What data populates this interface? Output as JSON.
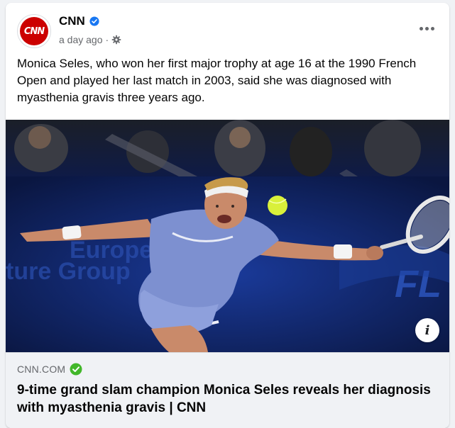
{
  "post": {
    "page_name": "CNN",
    "avatar_text": "CNN",
    "timestamp": "a day ago",
    "separator": "·",
    "body": "Monica Seles, who won her first major trophy at age 16 at the 1990 French Open and played her last match in 2003, said she was diagnosed with myasthenia gravis three years ago."
  },
  "photo": {
    "ad_text_1": "European",
    "ad_text_2": "ture Group",
    "ad_text_3": "FL"
  },
  "link": {
    "domain": "CNN.COM",
    "headline": "9-time grand slam champion Monica Seles reveals her diagnosis with myasthenia gravis | CNN",
    "info_glyph": "i"
  },
  "colors": {
    "brand_red": "#cc0000",
    "verified_blue": "#1877f2",
    "domain_check_green": "#42b72a",
    "secondary_text": "#65676b"
  },
  "icons": {
    "verified": "verified-badge-icon",
    "privacy": "gear-icon",
    "more": "more-options-icon",
    "info": "info-icon",
    "domain_verified": "check-circle-icon"
  }
}
